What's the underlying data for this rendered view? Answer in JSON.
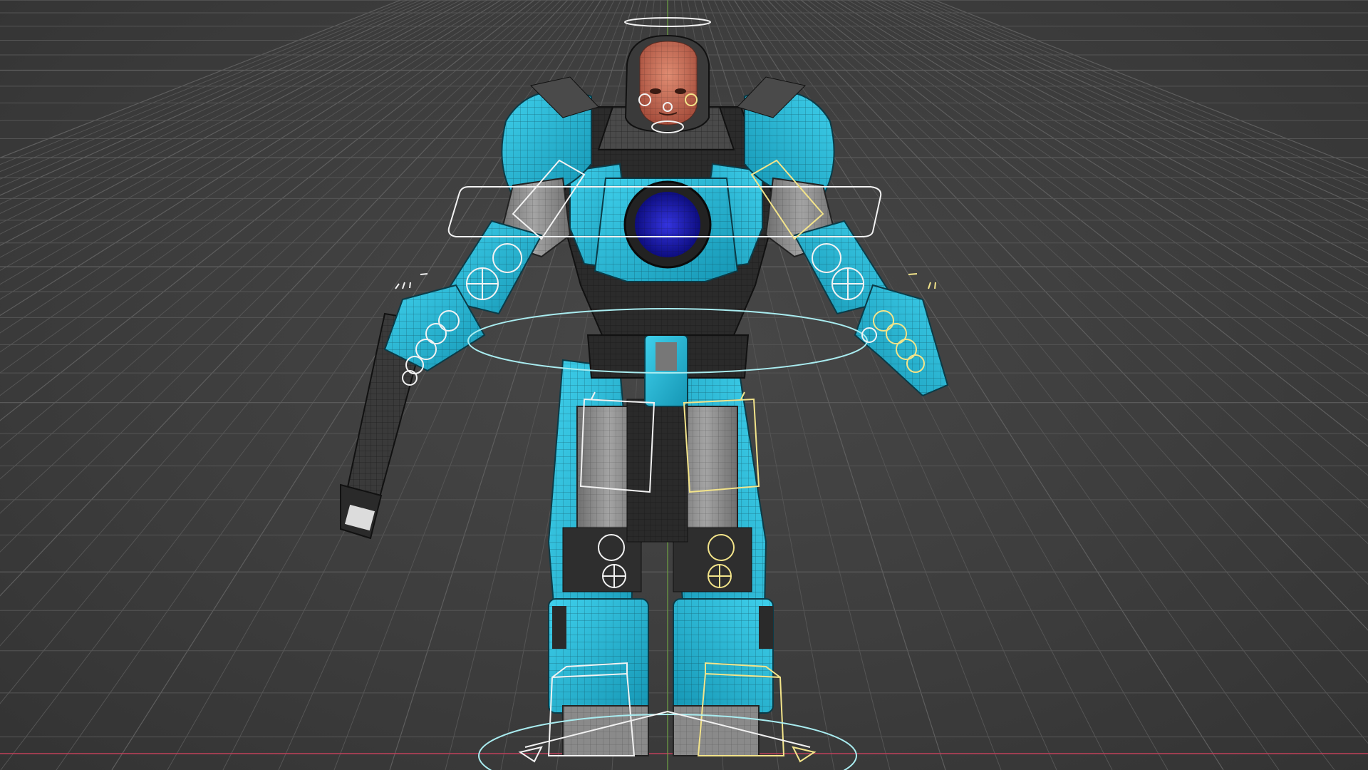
{
  "viewport": {
    "label": "",
    "colors": {
      "background": "#3d3d3d",
      "grid": "#555555",
      "armor_primary": "#23b6d6",
      "armor_dark": "#2b2b2b",
      "armor_grey": "#8e8e8e",
      "chest_core": "#1c1ca8",
      "head_skin": "#c96a55",
      "control_white": "#f2f2f2",
      "control_yellow": "#f3e48a",
      "control_cyan": "#a9ecf0",
      "axis_x": "#c0405a",
      "axis_y": "#6fb03b"
    },
    "icons": {
      "character": "mech-suit-character",
      "rig": "rig-controls"
    }
  }
}
